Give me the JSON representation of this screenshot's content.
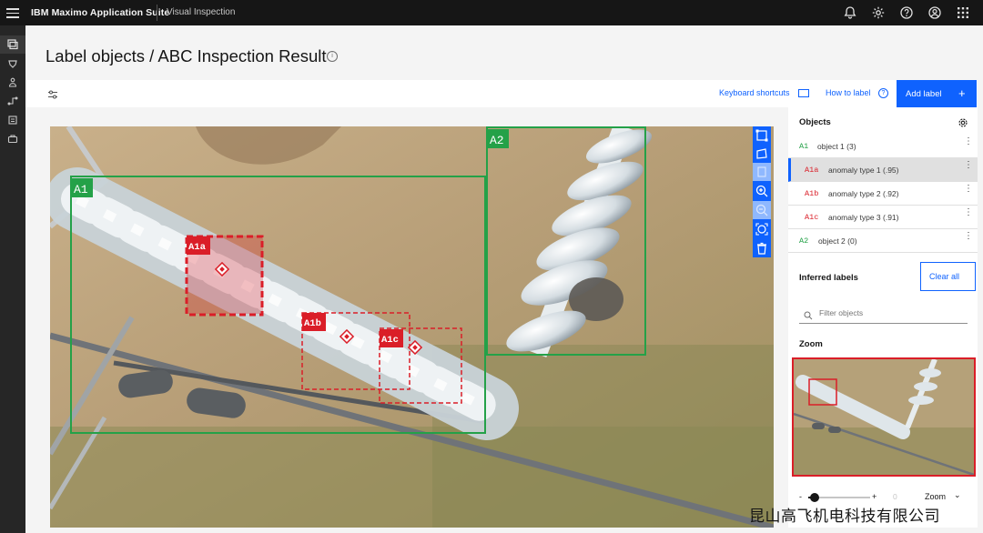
{
  "header": {
    "brand": "IBM Maximo Application Suite",
    "product": "Visual Inspection",
    "icons": [
      "menu-icon",
      "notification-icon",
      "settings-icon",
      "help-icon",
      "user-icon",
      "app-switcher-icon"
    ]
  },
  "sidebar": {
    "icons": [
      "datasets-icon",
      "models-icon",
      "deploy-icon",
      "workflow-icon",
      "reports-icon",
      "devices-icon"
    ]
  },
  "page": {
    "title": "Label objects / ABC Inspection Result",
    "info_icon": "information-icon"
  },
  "toolbar": {
    "keyboard_shortcuts": "Keyboard shortcuts",
    "how_to_label": "How to label",
    "add_label": "Add label",
    "add_label_plus": "+"
  },
  "canvas": {
    "boxes": [
      {
        "label": "A1",
        "kind": "object",
        "color": "#24a148"
      },
      {
        "label": "A2",
        "kind": "object",
        "color": "#24a148"
      },
      {
        "label": "A1a",
        "kind": "anomaly",
        "color": "#da1e28"
      },
      {
        "label": "A1b",
        "kind": "anomaly",
        "color": "#da1e28"
      },
      {
        "label": "A1c",
        "kind": "anomaly",
        "color": "#da1e28"
      }
    ],
    "tools": [
      "box-select-icon",
      "polygon-icon",
      "copy-icon",
      "zoom-in-icon",
      "zoom-out-icon",
      "zoom-fit-icon",
      "delete-icon"
    ]
  },
  "panel": {
    "objects_title": "Objects",
    "objects": [
      {
        "code": "A1",
        "name": "object 1 (3)",
        "type": "object",
        "selected": false
      },
      {
        "code": "A1a",
        "name": "anomaly type 1 (.95)",
        "type": "anomaly",
        "selected": true
      },
      {
        "code": "A1b",
        "name": "anomaly type 2 (.92)",
        "type": "anomaly",
        "selected": false
      },
      {
        "code": "A1c",
        "name": "anomaly type 3 (.91)",
        "type": "anomaly",
        "selected": false
      },
      {
        "code": "A2",
        "name": "object 2 (0)",
        "type": "object",
        "selected": false
      }
    ],
    "inferred_title": "Inferred labels",
    "clear_all": "Clear all",
    "filter_placeholder": "Filter objects",
    "zoom_title": "Zoom",
    "zoom_minus": "-",
    "zoom_plus": "+",
    "zoom_value": "0",
    "zoom_select": "Zoom",
    "zoom_level": 0.1
  },
  "watermark": "昆山高飞机电科技有限公司",
  "colors": {
    "accent": "#0f62fe",
    "object": "#24a148",
    "anomaly": "#da1e28"
  }
}
